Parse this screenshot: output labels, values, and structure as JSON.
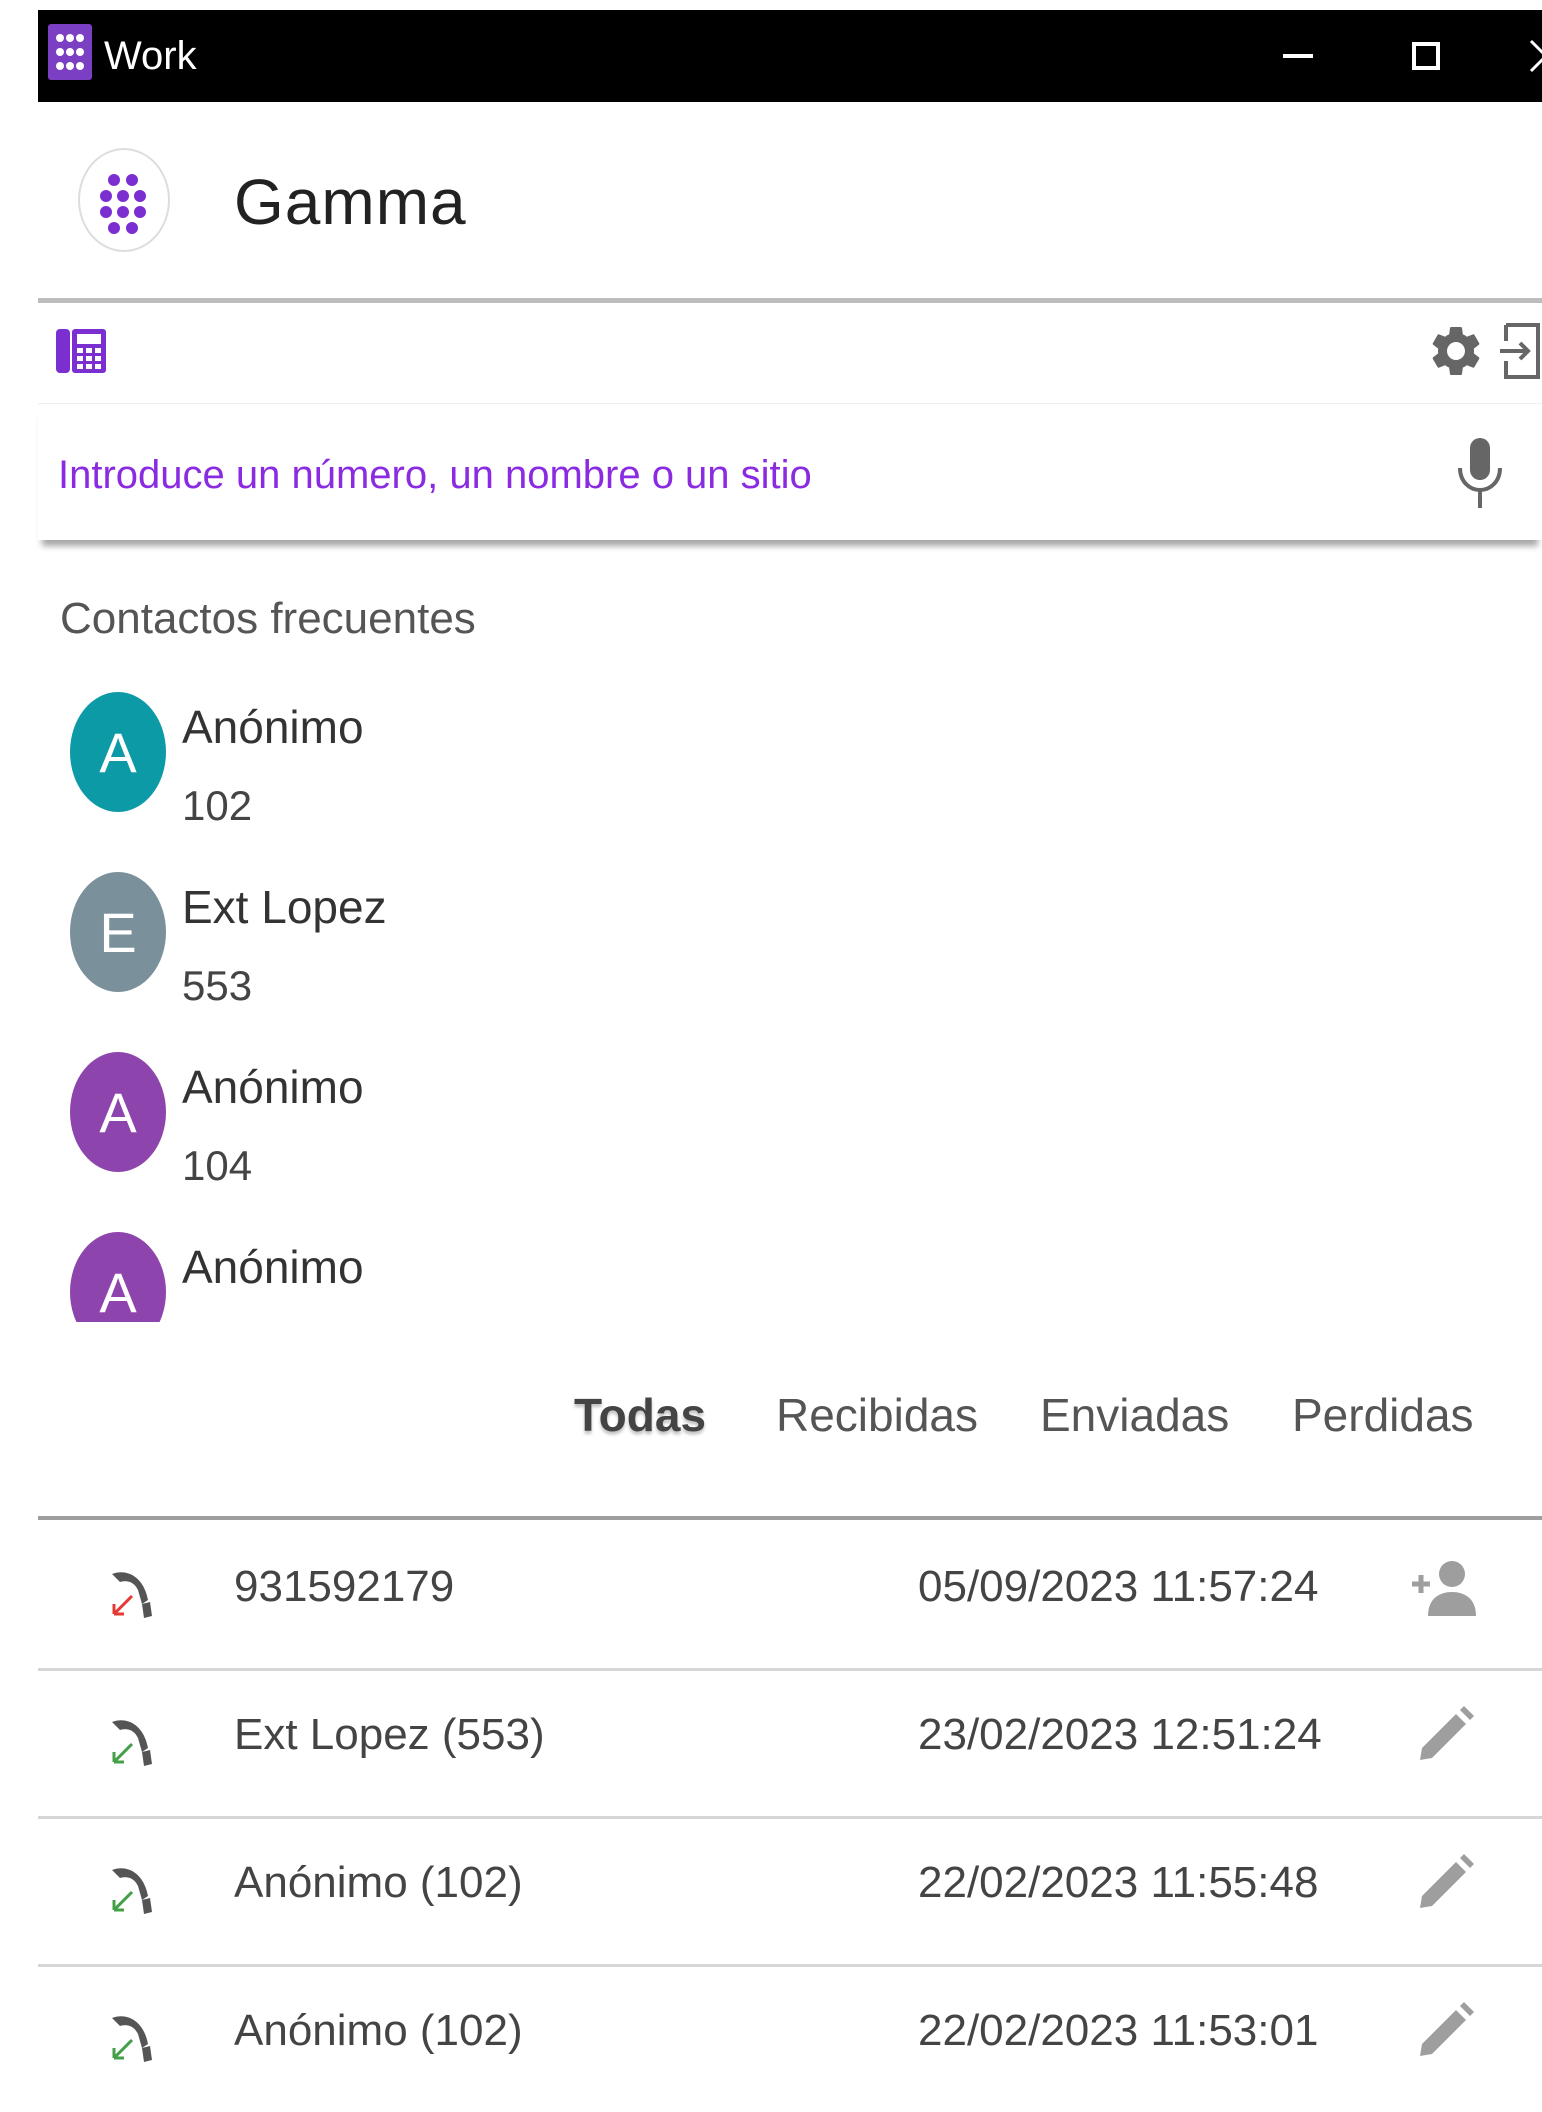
{
  "window": {
    "title": "Work",
    "controls": [
      "minimize",
      "maximize",
      "close"
    ]
  },
  "header": {
    "brand": "Gamma",
    "logo": "gamma-dots-logo"
  },
  "toolbar": {
    "left_icon": "phone-keypad-icon",
    "right_icons": [
      "gear-icon",
      "logout-icon"
    ]
  },
  "search": {
    "placeholder": "Introduce un número, un nombre o un sitio",
    "value": "",
    "mic_icon": "microphone-icon"
  },
  "frequent_contacts": {
    "title": "Contactos frecuentes",
    "items": [
      {
        "initial": "A",
        "name": "Anónimo",
        "number": "102",
        "color": "#0b9aa6"
      },
      {
        "initial": "E",
        "name": "Ext Lopez",
        "number": "553",
        "color": "#7a909a"
      },
      {
        "initial": "A",
        "name": "Anónimo",
        "number": "104",
        "color": "#8e44ad"
      },
      {
        "initial": "A",
        "name": "Anónimo",
        "number": "",
        "color": "#8e44ad"
      }
    ]
  },
  "tabs": {
    "items": [
      "Todas",
      "Recibidas",
      "Enviadas",
      "Perdidas"
    ],
    "selected": "Todas"
  },
  "calls": [
    {
      "type": "missed",
      "name": "931592179",
      "datetime": "05/09/2023 11:57:24",
      "action": "add-contact-icon"
    },
    {
      "type": "received",
      "name": "Ext Lopez (553)",
      "datetime": "23/02/2023 12:51:24",
      "action": "edit-pencil-icon"
    },
    {
      "type": "received",
      "name": "Anónimo (102)",
      "datetime": "22/02/2023 11:55:48",
      "action": "edit-pencil-icon"
    },
    {
      "type": "received",
      "name": "Anónimo (102)",
      "datetime": "22/02/2023 11:53:01",
      "action": "edit-pencil-icon"
    }
  ],
  "colors": {
    "accent": "#8a2be2",
    "titlebar": "#000000",
    "missed_arrow": "#e53935",
    "received_arrow": "#43a047",
    "icon_gray": "#9e9e9e"
  }
}
